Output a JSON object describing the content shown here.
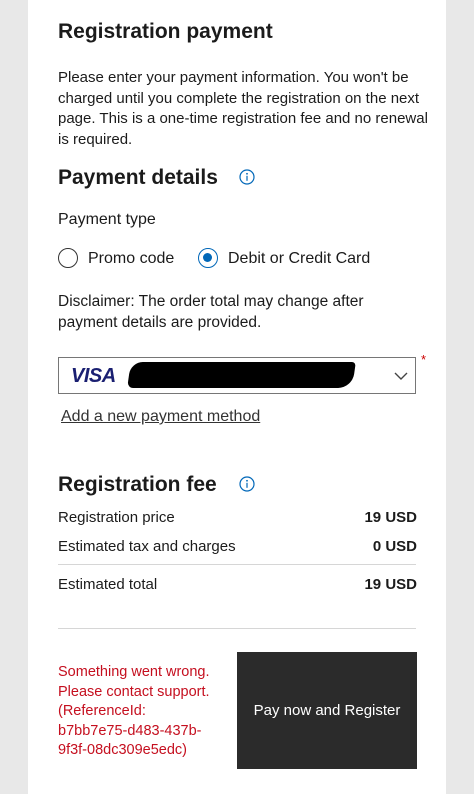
{
  "header": {
    "title": "Registration payment",
    "intro": "Please enter your payment information. You won't be charged until you complete the registration on the next page. This is a one-time registration fee and no renewal is required."
  },
  "payment_details": {
    "title": "Payment details",
    "payment_type_label": "Payment type",
    "options": [
      {
        "label": "Promo code",
        "selected": false
      },
      {
        "label": "Debit or Credit Card",
        "selected": true
      }
    ],
    "disclaimer": "Disclaimer: The order total may change after payment details are provided.",
    "card_brand": "VISA",
    "required_marker": "*",
    "add_method_link": "Add a new payment method"
  },
  "registration_fee": {
    "title": "Registration fee",
    "rows": [
      {
        "label": "Registration price",
        "value": "19 USD"
      },
      {
        "label": "Estimated tax and charges",
        "value": "0 USD"
      }
    ],
    "total_label": "Estimated total",
    "total_value": "19 USD"
  },
  "error_message": "Something went wrong. Please contact support. (ReferenceId: b7bb7e75-d483-437b-9f3f-08dc309e5edc)",
  "submit_button": "Pay now and Register",
  "colors": {
    "accent": "#0067b8",
    "error": "#c50f1f",
    "button_bg": "#2b2b2b"
  }
}
